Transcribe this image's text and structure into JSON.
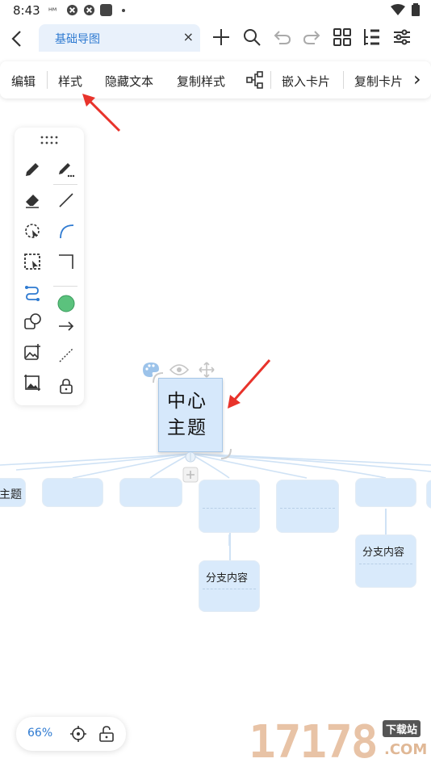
{
  "status": {
    "time": "8:43",
    "carrier_icon": "signal-text-icon",
    "app_icons": [
      "vpn-icon",
      "vpn-icon",
      "app-icon"
    ]
  },
  "topbar": {
    "back_icon": "back-icon",
    "tab_title": "基础导图",
    "tab_close": "×",
    "actions": [
      "add-icon",
      "search-icon",
      "undo-icon",
      "redo-icon",
      "grid-icon",
      "outline-icon",
      "settings-icon"
    ]
  },
  "menubar": {
    "items": [
      "编辑",
      "样式",
      "隐藏文本",
      "复制样式",
      "嵌入卡片",
      "复制卡片"
    ],
    "more": "›"
  },
  "mindmap": {
    "central_topic": "中心主题",
    "left_partial": "主题",
    "leaf_1": "分支内容",
    "leaf_2": "分支内容"
  },
  "bottombar": {
    "zoom": "66%"
  },
  "watermark": {
    "text": "17178",
    "sub": "下载站",
    "domain": ".COM"
  },
  "colors": {
    "accent": "#2e7ad1",
    "node_fill": "#d9eafb",
    "annotation_arrow": "#e8332b",
    "green_circle": "#5bc27d"
  }
}
